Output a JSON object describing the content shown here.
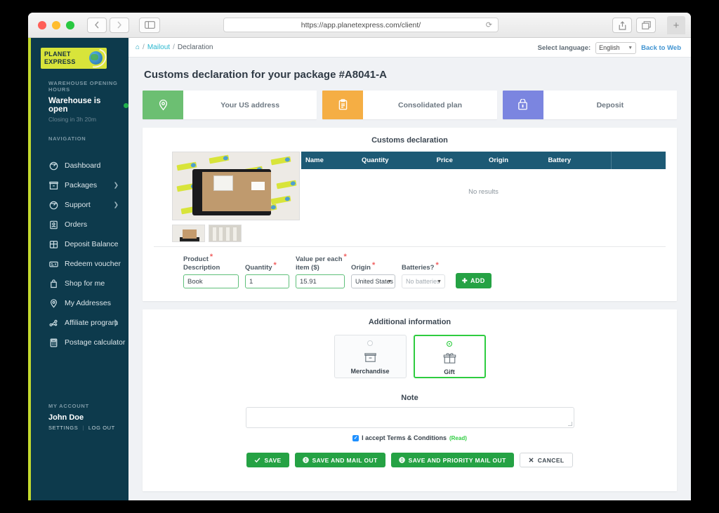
{
  "browser": {
    "url": "https://app.planetexpress.com/client/",
    "back_icon": "chevron-left-icon",
    "forward_icon": "chevron-right-icon",
    "sidebar_icon": "sidebar-toggle-icon",
    "reload_icon": "reload-icon",
    "share_icon": "share-icon",
    "tabs_icon": "tab-overview-icon",
    "newtab_label": "+"
  },
  "sidebar": {
    "logo_line1": "PLANET",
    "logo_line2": "EXPRESS",
    "warehouse_heading": "WAREHOUSE OPENING HOURS",
    "warehouse_status": "Warehouse is open",
    "warehouse_closing": "Closing in 3h 20m",
    "nav_heading": "NAVIGATION",
    "items": [
      {
        "label": "Dashboard",
        "icon": "dashboard-icon",
        "chevron": false
      },
      {
        "label": "Packages",
        "icon": "package-icon",
        "chevron": true
      },
      {
        "label": "Support",
        "icon": "support-icon",
        "chevron": true
      },
      {
        "label": "Orders",
        "icon": "orders-icon",
        "chevron": false
      },
      {
        "label": "Deposit Balance",
        "icon": "deposit-icon",
        "chevron": false
      },
      {
        "label": "Redeem voucher",
        "icon": "voucher-icon",
        "chevron": false
      },
      {
        "label": "Shop for me",
        "icon": "shopping-bag-icon",
        "chevron": false
      },
      {
        "label": "My Addresses",
        "icon": "location-pin-icon",
        "chevron": false
      },
      {
        "label": "Affiliate program",
        "icon": "network-icon",
        "chevron": true
      },
      {
        "label": "Postage calculator",
        "icon": "calculator-icon",
        "chevron": false
      }
    ],
    "account_heading": "MY ACCOUNT",
    "account_name": "John Doe",
    "settings_label": "SETTINGS",
    "logout_label": "LOG OUT"
  },
  "topbar": {
    "home_icon": "home-icon",
    "breadcrumb_link": "Mailout",
    "breadcrumb_sep": "/",
    "breadcrumb_current": "Declaration",
    "select_language_label": "Select language:",
    "language_value": "English",
    "back_to_web": "Back to Web"
  },
  "page": {
    "title": "Customs declaration for your package #A8041-A"
  },
  "steps": [
    {
      "label": "Your US address",
      "icon": "location-pin-icon",
      "color": "#6cbf72",
      "variant": "green"
    },
    {
      "label": "Consolidated plan",
      "icon": "clipboard-icon",
      "color": "#f5ae44",
      "variant": "orange"
    },
    {
      "label": "Deposit",
      "icon": "deposit-box-icon",
      "color": "#7b85e0",
      "variant": "purple"
    }
  ],
  "declaration": {
    "title": "Customs declaration",
    "table": {
      "headers": [
        "Name",
        "Quantity",
        "Price",
        "Origin",
        "Battery",
        ""
      ],
      "rows": [],
      "empty_text": "No results"
    },
    "photo_alt": "package-photo",
    "form": {
      "fields": [
        {
          "label_line1": "Product",
          "label_line2": "Description",
          "required": true,
          "value": "Book",
          "type": "text",
          "name": "product-description-input"
        },
        {
          "label_line1": "Quantity",
          "label_line2": "",
          "required": true,
          "value": "1",
          "type": "text",
          "name": "quantity-input"
        },
        {
          "label_line1": "Value per each",
          "label_line2": "item ($)",
          "required": true,
          "value": "15.91",
          "type": "text",
          "name": "value-per-item-input"
        },
        {
          "label_line1": "Origin",
          "label_line2": "",
          "required": true,
          "value": "United States",
          "type": "select",
          "name": "origin-select"
        },
        {
          "label_line1": "Batteries?",
          "label_line2": "",
          "required": true,
          "value": "No batteries",
          "type": "select",
          "name": "batteries-select"
        }
      ],
      "add_button": "ADD",
      "add_icon": "plus-icon"
    }
  },
  "additional": {
    "title": "Additional information",
    "types": [
      {
        "label": "Merchandise",
        "icon": "box-icon",
        "selected": false
      },
      {
        "label": "Gift",
        "icon": "gift-icon",
        "selected": true
      }
    ],
    "note_label": "Note",
    "note_value": "",
    "terms_checked": true,
    "terms_label": "I accept Terms & Conditions",
    "terms_read": "(Read)"
  },
  "footer": {
    "buttons": [
      {
        "label": "SAVE",
        "icon": "check-icon",
        "style": "primary"
      },
      {
        "label": "SAVE AND MAIL OUT",
        "icon": "globe-icon",
        "style": "primary"
      },
      {
        "label": "SAVE AND PRIORITY MAIL OUT",
        "icon": "globe-icon",
        "style": "primary"
      },
      {
        "label": "CANCEL",
        "icon": "x-icon",
        "style": "cancel"
      }
    ]
  },
  "colors": {
    "sidebar_bg": "#0d3a4c",
    "sidebar_accent": "#c2d92e",
    "table_header": "#1d5a75",
    "green": "#25a244",
    "step_green": "#6cbf72",
    "step_orange": "#f5ae44",
    "step_purple": "#7b85e0",
    "link_blue": "#3f93d1"
  }
}
